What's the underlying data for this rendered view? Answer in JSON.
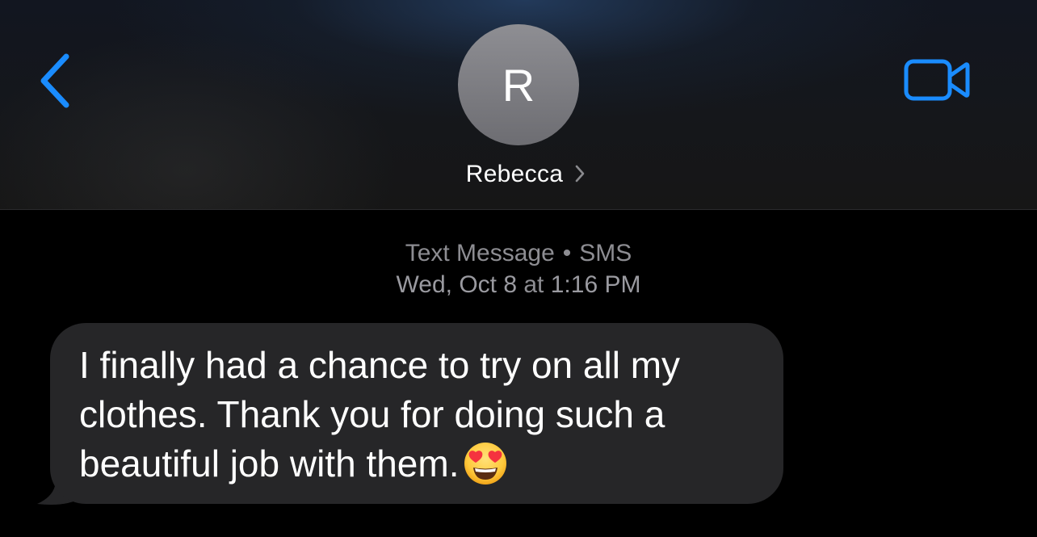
{
  "header": {
    "back_icon": "chevron-left-icon",
    "video_icon": "video-camera-icon",
    "avatar_initial": "R",
    "contact_name": "Rebecca",
    "accent_color": "#1a8cff"
  },
  "conversation": {
    "service_label": "Text Message",
    "service_separator": "•",
    "service_type": "SMS",
    "date": "Wed, Oct 8",
    "at": "at",
    "time": "1:16 PM"
  },
  "messages": [
    {
      "direction": "incoming",
      "text": "I finally had a chance to try on all my clothes. Thank you for doing such a beautiful job with them.",
      "emoji": "smiling-face-with-heart-eyes",
      "bubble_color": "#262628"
    }
  ]
}
